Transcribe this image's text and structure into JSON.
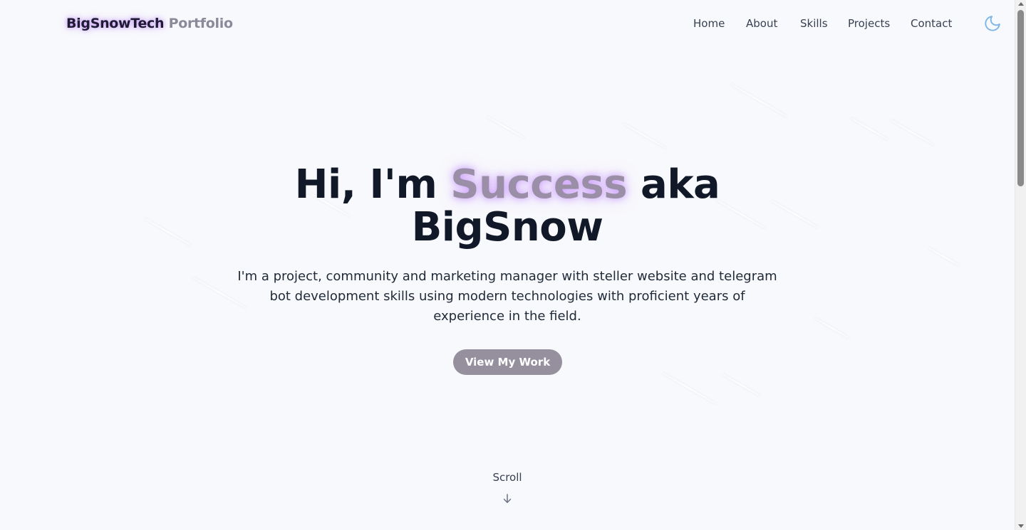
{
  "header": {
    "brand_primary": "BigSnowTech",
    "brand_secondary": "Portfolio",
    "nav": [
      {
        "label": "Home"
      },
      {
        "label": "About"
      },
      {
        "label": "Skills"
      },
      {
        "label": "Projects"
      },
      {
        "label": "Contact"
      }
    ],
    "theme_icon": "moon-icon"
  },
  "hero": {
    "title_prefix": "Hi, I'm ",
    "title_accent": "Success",
    "title_suffix": " aka",
    "title_line2": "BigSnow",
    "subtitle": "I'm a project, community and marketing manager with steller website and telegram bot development skills using modern technologies with proficient years of experience in the field.",
    "cta_label": "View My Work"
  },
  "scroll": {
    "label": "Scroll",
    "icon": "arrow-down-icon"
  },
  "colors": {
    "background": "#f8f9fc",
    "text": "#111827",
    "accent_glow": "#c084fc",
    "button": "#958f9e",
    "moon": "#7fb6e6"
  }
}
